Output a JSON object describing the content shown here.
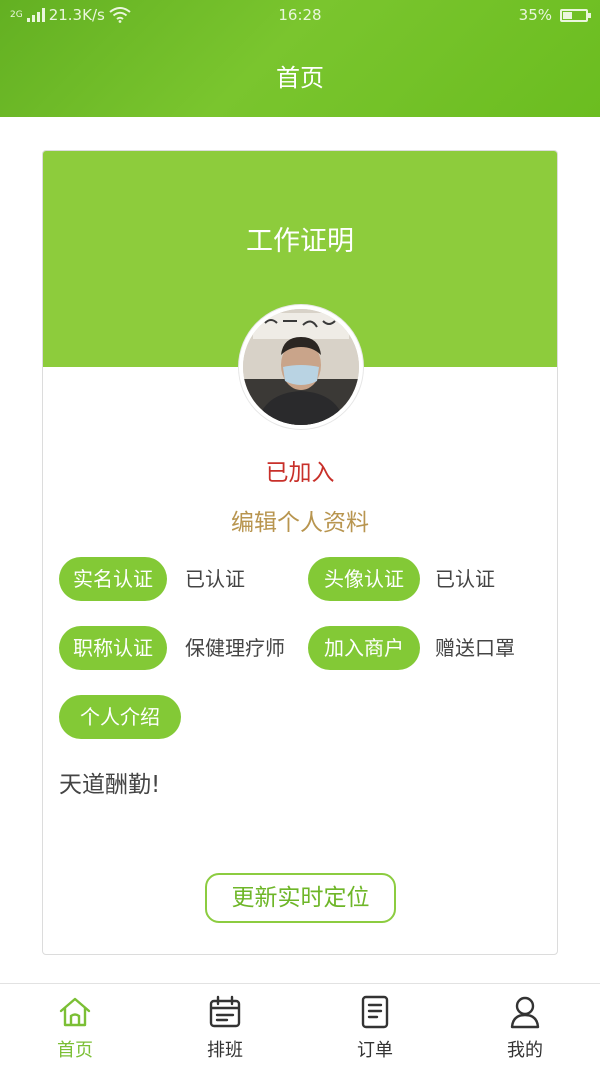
{
  "status_bar": {
    "network_label": "2G",
    "speed": "21.3K/s",
    "time": "16:28",
    "battery": "35%"
  },
  "header": {
    "title": "首页"
  },
  "card": {
    "title": "工作证明",
    "status": "已加入",
    "edit_link": "编辑个人资料",
    "fields": [
      {
        "label": "实名认证",
        "value": "已认证"
      },
      {
        "label": "头像认证",
        "value": "已认证"
      },
      {
        "label": "职称认证",
        "value": "保健理疗师"
      },
      {
        "label": "加入商户",
        "value": "赠送口罩"
      },
      {
        "label": "个人介绍",
        "value": ""
      }
    ],
    "intro_text": "天道酬勤!",
    "update_button": "更新实时定位"
  },
  "tabbar": {
    "items": [
      {
        "label": "首页",
        "icon": "home-icon",
        "active": true
      },
      {
        "label": "排班",
        "icon": "calendar-icon",
        "active": false
      },
      {
        "label": "订单",
        "icon": "document-icon",
        "active": false
      },
      {
        "label": "我的",
        "icon": "user-icon",
        "active": false
      }
    ]
  },
  "colors": {
    "primary_green": "#8dcc3c",
    "status_red": "#c8302a",
    "edit_gold": "#b8954f"
  }
}
